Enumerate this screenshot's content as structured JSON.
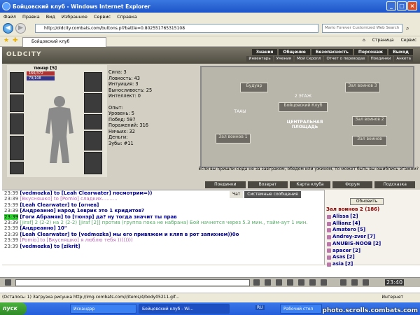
{
  "window": {
    "title": "Бойцовский клуб - Windows Internet Explorer",
    "menu": [
      "Файл",
      "Правка",
      "Вид",
      "Избранное",
      "Сервис",
      "Справка"
    ]
  },
  "address_bar": {
    "url": "http://oldcity.combats.com/buttons.pl?battle=0.802551765315108",
    "search_placeholder": "Mario Forever Customized Web Search"
  },
  "favorites_bar": {
    "tab_title": "Бойцовский клуб",
    "page_menu": "Страница",
    "tools_menu": "Сервис"
  },
  "game_header": {
    "logo": "OLDCITY",
    "nav_top": [
      "Знания",
      "Общение",
      "Безопасность",
      "Персонаж",
      "Выход"
    ],
    "nav_bottom": [
      "Инвентарь",
      "Умения",
      "Мой Скролл",
      "Отчет о переводах",
      "Поединки",
      "Анкета"
    ]
  },
  "character": {
    "name": "тюнэр",
    "level": "[5]",
    "hp": "166/372",
    "mana": "79/108"
  },
  "stats": {
    "lines": [
      "Сила: 3",
      "Ловкость: 43",
      "Интуиция: 3",
      "Выносливость: 25",
      "Интеллект: 0"
    ],
    "lines2": [
      "Опыт:",
      "Уровень: 5",
      "Побед: 597",
      "Поражений: 316",
      "Ничьих: 32",
      "Деньги:",
      "Зубы: #11"
    ]
  },
  "map": {
    "rooms": [
      "Будуар",
      "Зал воинов 3",
      "Зал воинов 1",
      "Бойцовский Клуб",
      "2 ЭТАЖ",
      "ТААЫ",
      "ЦЕНТРАЛЬНАЯ ПЛОЩАДЬ",
      "Зал воинов 2",
      "Зал воинов"
    ],
    "question": "Если вы пришли сюда не за завтраком, обедом или ужином, то может быть вы ошиблись этажом?"
  },
  "action_buttons": [
    "Поединки",
    "Возврат",
    "Карта клуба",
    "Форум",
    "Подсказка"
  ],
  "chat_tabs": [
    "Чат",
    "Системные сообщения"
  ],
  "chat": [
    {
      "time": "23:39",
      "text": "[vedmozka] to [Leah Clearwater] посмотрим=))"
    },
    {
      "time": "23:39",
      "text": "[Вкусняшко] to [Pomio] сладких.........."
    },
    {
      "time": "23:39",
      "text": "[Leah Clearwater] to [огнев]"
    },
    {
      "time": "23:39",
      "text": "[Андреанно] народ 1еврик это 1 кридитов?"
    },
    {
      "time": "23:39",
      "text": "[Гоги Абрамян] to [тюнэр] да? ну тогда значит ты прав"
    },
    {
      "time": "23:39",
      "text": "[jiraf] 2 (2-2) на 2 (2-2) [jiraf [2]] против (группа пока не набрана) Бой начнется через 5.3 мин., тайм-аут 1 мин."
    },
    {
      "time": "23:39",
      "text": "[Андреанно] 10\""
    },
    {
      "time": "23:39",
      "text": "[Leah Clearwater] to [vedmozka] мы его привяжем и кляп в рот запихнем))0о"
    },
    {
      "time": "23:39",
      "text": "[Pomio] to [Вкусняшко] я люблю тебя ))))))))"
    },
    {
      "time": "23:39",
      "text": "[vedmozka] to [zikrit]"
    }
  ],
  "users_panel": {
    "refresh_label": "Обновить",
    "room_label": "Зал воинов 2 (186)",
    "users": [
      {
        "name": "Alissa",
        "level": "[2]"
      },
      {
        "name": "Allianz",
        "level": "[4]"
      },
      {
        "name": "Amatero",
        "level": "[5]"
      },
      {
        "name": "Andrey-zver",
        "level": "[7]"
      },
      {
        "name": "ANUBIS-NOOB",
        "level": "[2]"
      },
      {
        "name": "apacer",
        "level": "[2]"
      },
      {
        "name": "Asas",
        "level": "[2]"
      },
      {
        "name": "asia",
        "level": "[2]"
      }
    ]
  },
  "clock": "23:40",
  "status_bar": {
    "text": "(Осталось: 1) Загрузка рисунка http://img.combats.com/i/items/4/body05211.gif...",
    "zone": "Интернет"
  },
  "taskbar": {
    "start": "пуск",
    "tasks": [
      "Искандэр",
      "Бойцовский клуб - Wi...",
      "Рабочий стол"
    ],
    "lang": "RU"
  },
  "watermark": "photo.scrolls.combats.com",
  "colors": {
    "title_blue": "#1d54c8",
    "game_dark": "#4a4840",
    "nick_blue": "#00008b"
  }
}
